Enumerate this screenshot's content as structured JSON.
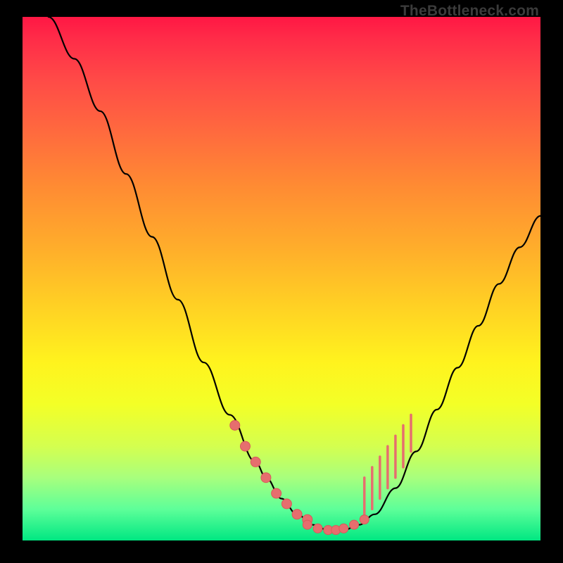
{
  "watermark": {
    "text": "TheBottleneck.com"
  },
  "colors": {
    "dot": "#e66e6e",
    "curve": "#000000",
    "background_top": "#ff1744",
    "background_bottom": "#00e782"
  },
  "chart_data": {
    "type": "line",
    "title": "",
    "xlabel": "",
    "ylabel": "",
    "xlim": [
      0,
      100
    ],
    "ylim": [
      0,
      100
    ],
    "grid": false,
    "series": [
      {
        "name": "bottleneck-curve",
        "x": [
          5,
          10,
          15,
          20,
          25,
          30,
          35,
          40,
          45,
          47,
          50,
          53,
          56,
          59,
          62,
          65,
          68,
          72,
          76,
          80,
          84,
          88,
          92,
          96,
          100
        ],
        "y": [
          100,
          92,
          82,
          70,
          58,
          46,
          34,
          24,
          15,
          12,
          8,
          5,
          3,
          2,
          2,
          3,
          5,
          10,
          17,
          25,
          33,
          41,
          49,
          56,
          62
        ]
      }
    ],
    "markers_left": {
      "name": "highlighted-points-descending",
      "x": [
        41,
        43,
        45,
        47,
        49,
        51,
        53,
        55
      ],
      "y": [
        22,
        18,
        15,
        12,
        9,
        7,
        5,
        4
      ]
    },
    "markers_right_bars": {
      "name": "highlighted-bars-ascending",
      "x": [
        66,
        67.5,
        69,
        70.5,
        72,
        73.5,
        75
      ],
      "y_top": [
        12,
        14,
        16,
        18,
        20,
        22,
        24
      ],
      "y_bottom": [
        4,
        6,
        8,
        10,
        12,
        14,
        17
      ]
    },
    "markers_bottom": {
      "name": "highlighted-points-trough",
      "x": [
        55,
        57,
        59,
        60.5,
        62,
        64,
        66
      ],
      "y": [
        3,
        2.3,
        2,
        2,
        2.3,
        3,
        4
      ]
    }
  }
}
